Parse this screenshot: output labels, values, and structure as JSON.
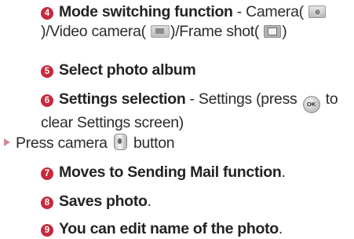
{
  "colors": {
    "accent": "#c6283c",
    "text": "#2b2b2b",
    "bullet_arrow": "#d08a96"
  },
  "items": [
    {
      "number": "4",
      "title": "Mode switching function",
      "separator": " - ",
      "text_a": "Camera(",
      "text_b": ")/Video camera(",
      "text_c": ")/Frame shot(",
      "text_d": ")"
    },
    {
      "number": "5",
      "title": "Select photo album"
    },
    {
      "number": "6",
      "title": "Settings selection",
      "separator": " - ",
      "text_a": "Settings (press",
      "text_b": "to clear Settings screen)",
      "ok_icon_label": "OK"
    },
    {
      "bullet": "arrow",
      "text_a": "Press camera",
      "text_b": "button"
    },
    {
      "number": "7",
      "title": "Moves to Sending Mail function",
      "trailing": "."
    },
    {
      "number": "8",
      "title": "Saves photo",
      "trailing": "."
    },
    {
      "number": "9",
      "title": "You can edit name of the photo",
      "trailing": "."
    }
  ],
  "icons": {
    "camera": "camera-mode-icon",
    "video": "video-mode-icon",
    "frame": "frame-shot-icon",
    "ok": "ok-key-icon",
    "camera_button": "camera-button-icon"
  }
}
